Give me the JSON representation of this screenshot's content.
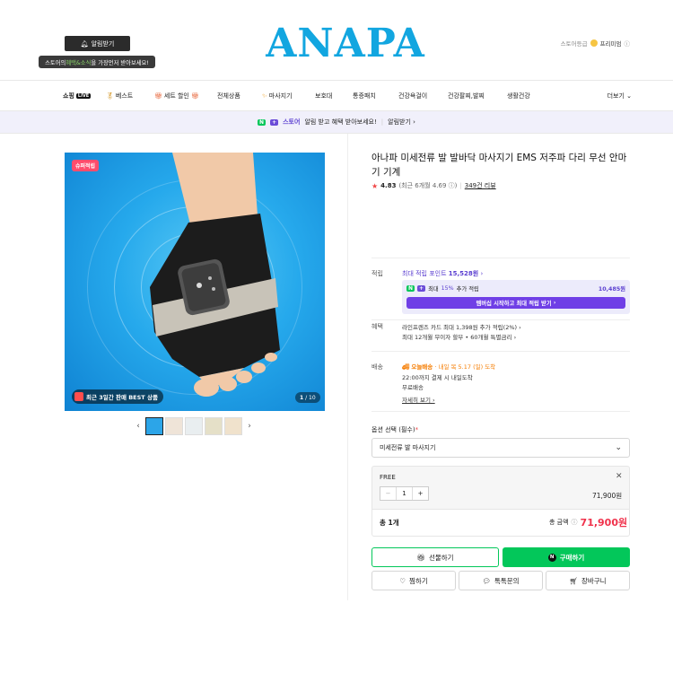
{
  "header": {
    "alarm_button": "알림받기",
    "alarm_tip_pre": "스토어의 ",
    "alarm_tip_hl": "혜택&소식",
    "alarm_tip_post": "을 가장먼저 받아보세요!",
    "logo": "ANAPA",
    "grade_label": "스토어등급",
    "grade_value": "프리미엄"
  },
  "nav": {
    "items": [
      {
        "label": "쇼핑",
        "badge": "LIVE"
      },
      {
        "label": "베스트"
      },
      {
        "label": "세트 할인"
      },
      {
        "label": "전체상품"
      },
      {
        "label": "마사지기"
      },
      {
        "label": "보호대"
      },
      {
        "label": "통증패치"
      },
      {
        "label": "건강욕걸이"
      },
      {
        "label": "건강팔찌,발찌"
      },
      {
        "label": "생활건강"
      }
    ],
    "more": "더보기"
  },
  "banner": {
    "store_label": "스토어",
    "text": "알림 받고 혜택 받아보세요!",
    "link": "알림받기"
  },
  "gallery": {
    "super_badge": "슈퍼적립",
    "best_badge": "최근 3일간 판매 BEST 상품",
    "counter_current": "1",
    "counter_total": "10",
    "thumb_count": 5
  },
  "product": {
    "title": "아나파 미세전류 발 발바닥 마사지기 EMS 저주파 다리 무선 안마기 기계",
    "rating": "4.83",
    "rating_recent": "(최근 6개월 4.69",
    "review_count": "349건 리뷰"
  },
  "points": {
    "label": "적립",
    "max_text": "최대 적립 포인트",
    "max_value": "15,528원",
    "extra_text": "최대",
    "extra_pct": "15%",
    "extra_suffix": "추가 적립",
    "extra_value": "10,485원",
    "membership_btn": "멤버십 시작하고 최대 적립 받기"
  },
  "benefit": {
    "label": "혜택",
    "line1": "라인프렌즈 카드 최대 1,398원 추가 적립(2%)",
    "line2": "최대 12개월 무이자 할부 • 60개월 특별금리"
  },
  "shipping": {
    "label": "배송",
    "today": "오늘배송",
    "date": "· 내일 목 5.17 (일) 도착",
    "deadline": "22:00까지 결제 시 내일도착",
    "free": "무료배송",
    "detail": "자세히 보기"
  },
  "option": {
    "label": "옵션 선택 (필수)",
    "required_mark": "*",
    "selected": "미세전류 발 마사지기",
    "item_name": "FREE",
    "quantity": "1",
    "line_price": "71,900원",
    "total_count": "총 1개",
    "total_label": "총 금액",
    "total_price": "71,900원"
  },
  "actions": {
    "gift": "선물하기",
    "buy": "구매하기",
    "wish": "찜하기",
    "talk": "톡톡문의",
    "cart": "장바구니"
  },
  "colors": {
    "naver_green": "#03c75a",
    "store_purple": "#5b3fd0",
    "price_red": "#f0314b",
    "logo_blue": "#12a6e0"
  }
}
